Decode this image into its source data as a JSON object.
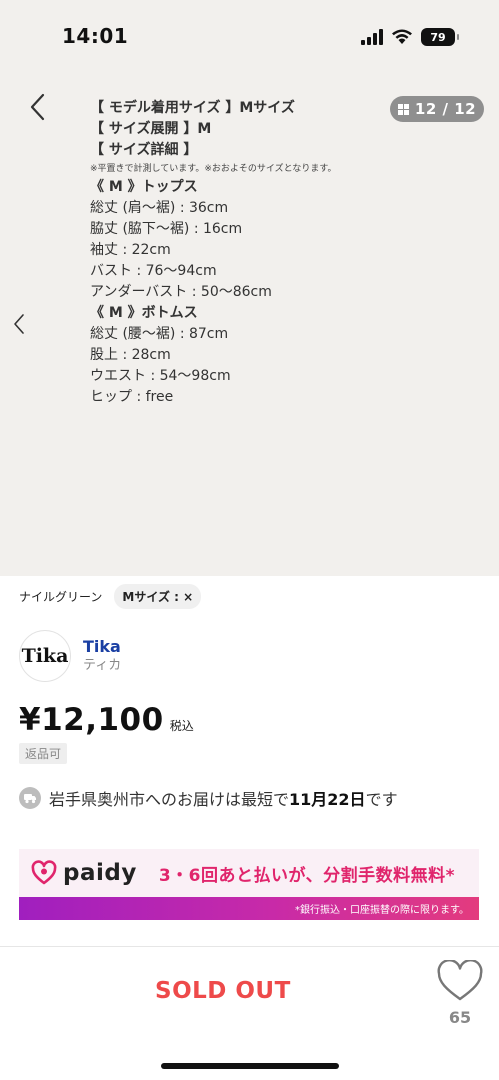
{
  "status_bar": {
    "time": "14:01",
    "battery": "79"
  },
  "gallery": {
    "page_badge": "12 / 12",
    "spec_lines": [
      {
        "text": "【 モデル着用サイズ 】Mサイズ",
        "style": "b"
      },
      {
        "text": "【 サイズ展開 】M",
        "style": "b"
      },
      {
        "text": "【 サイズ詳細 】",
        "style": "b"
      },
      {
        "text": "※平置きで計測しています。※おおよそのサイズとなります。",
        "style": "note"
      },
      {
        "text": "《 M 》トップス",
        "style": "b"
      },
      {
        "text": "総丈 (肩〜裾) : 36cm",
        "style": ""
      },
      {
        "text": "脇丈 (脇下〜裾) : 16cm",
        "style": ""
      },
      {
        "text": "袖丈 : 22cm",
        "style": ""
      },
      {
        "text": "バスト : 76〜94cm",
        "style": ""
      },
      {
        "text": "アンダーバスト : 50〜86cm",
        "style": ""
      },
      {
        "text": "《 M 》ボトムス",
        "style": "b"
      },
      {
        "text": "総丈 (腰〜裾) : 87cm",
        "style": ""
      },
      {
        "text": "股上 : 28cm",
        "style": ""
      },
      {
        "text": "ウエスト : 54〜98cm",
        "style": ""
      },
      {
        "text": "ヒップ : free",
        "style": ""
      }
    ]
  },
  "variation": {
    "color": "ナイルグリーン",
    "size_chip": "Mサイズ : ×"
  },
  "shop": {
    "logo_text": "Tika",
    "name": "Tika",
    "name_kana": "ティカ"
  },
  "price": {
    "amount": "¥12,100",
    "tax_label": "税込"
  },
  "return_badge": "返品可",
  "delivery": {
    "prefix": "岩手県奥州市へのお届けは最短で",
    "date": "11月22日",
    "suffix": "です"
  },
  "paidy": {
    "logo_text": "paidy",
    "promo": "3・6回あと払いが、分割手数料無料*",
    "footnote": "*銀行振込・口座振替の際に限ります。",
    "accent": "#e0256c"
  },
  "bottom_bar": {
    "sold_out": "SOLD OUT",
    "like_count": "65"
  }
}
